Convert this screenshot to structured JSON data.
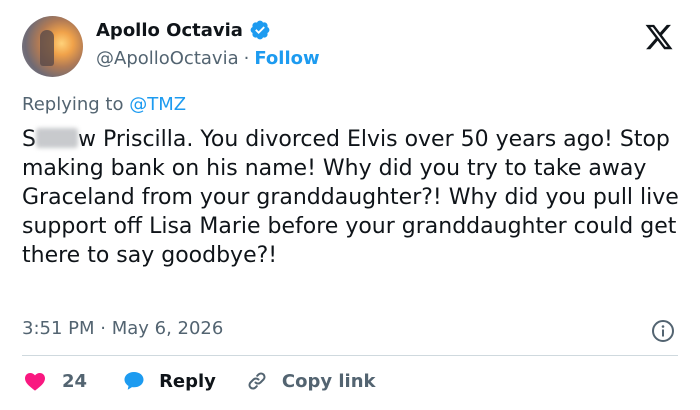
{
  "author": {
    "display_name": "Apollo Octavia",
    "handle": "@ApolloOctavia",
    "separator": "·",
    "follow_label": "Follow"
  },
  "reply_context": {
    "prefix": "Replying to",
    "mention": "@TMZ"
  },
  "tweet": {
    "text_start": "S",
    "text_rest": "w Priscilla. You divorced Elvis over 50 years ago! Stop making bank on his name! Why did you try to take away Graceland from your granddaughter?! Why did you pull live support off Lisa Marie before your granddaughter could get there to say goodbye?!",
    "timestamp": "3:51 PM · May 6, 2026"
  },
  "actions": {
    "like_count": "24",
    "reply_label": "Reply",
    "copy_link_label": "Copy link"
  },
  "icons": {
    "verified": "verified-badge-icon",
    "platform": "x-logo-icon",
    "info": "info-icon",
    "like": "heart-icon",
    "reply": "speech-bubble-icon",
    "copy": "link-icon"
  },
  "colors": {
    "accent": "#1d9bf0",
    "like": "#f91880",
    "muted": "#536471",
    "text": "#0f1419"
  }
}
